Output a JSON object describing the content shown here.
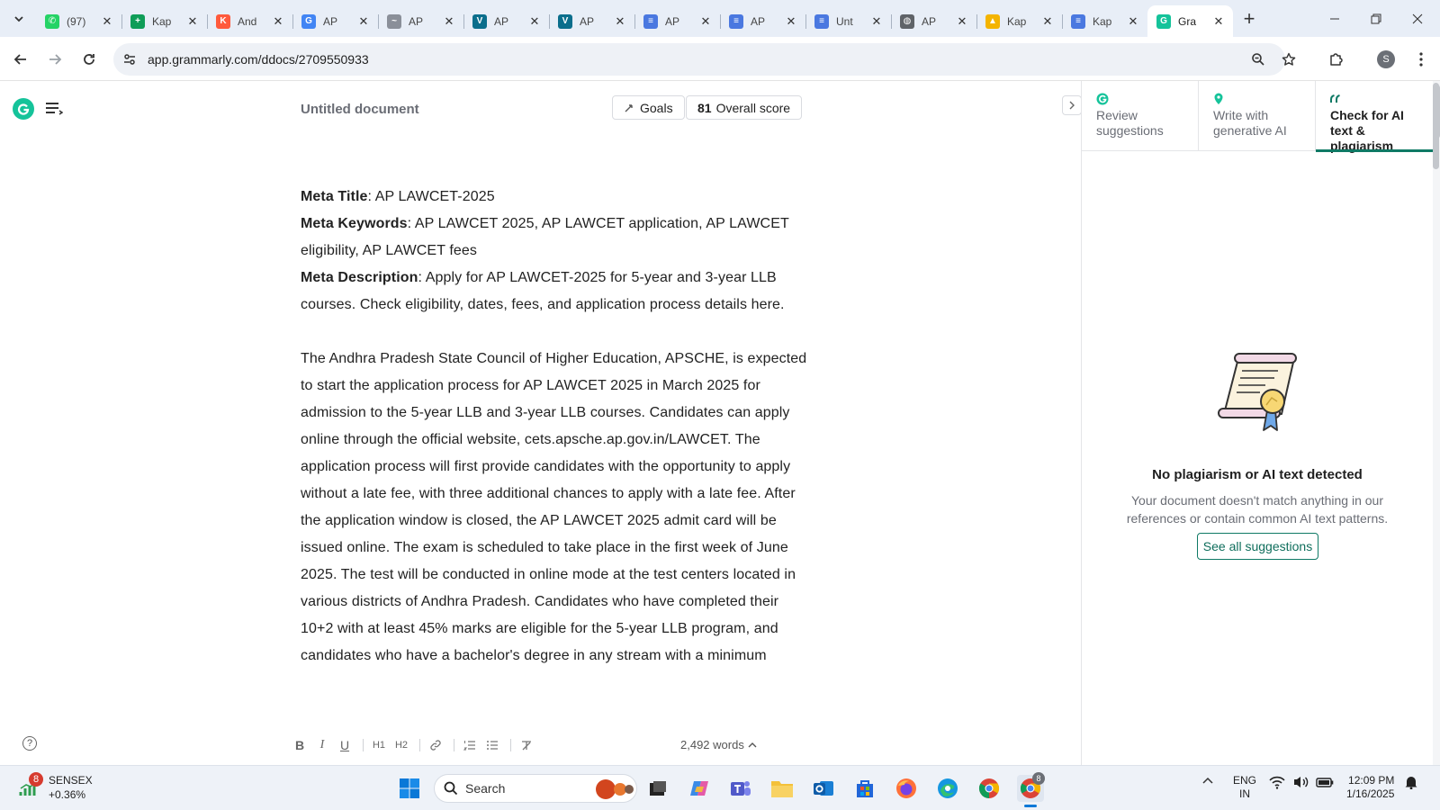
{
  "browser": {
    "tabs": [
      {
        "title": "(97)",
        "favicon": "whatsapp-icon",
        "color": "#25d366",
        "glyph": "✆"
      },
      {
        "title": "Kap",
        "favicon": "sheets-icon",
        "color": "#0f9d58",
        "glyph": "+"
      },
      {
        "title": "And",
        "favicon": "k-icon",
        "color": "#ff5a3c",
        "glyph": "K"
      },
      {
        "title": "AP",
        "favicon": "google-icon",
        "color": "#4285f4",
        "glyph": "G"
      },
      {
        "title": "AP",
        "favicon": "site-icon",
        "color": "#8a8f99",
        "glyph": "~"
      },
      {
        "title": "AP",
        "favicon": "v-icon",
        "color": "#0b6e8c",
        "glyph": "V"
      },
      {
        "title": "AP",
        "favicon": "v-icon",
        "color": "#0b6e8c",
        "glyph": "V"
      },
      {
        "title": "AP",
        "favicon": "docs-icon",
        "color": "#4a78e0",
        "glyph": "≡"
      },
      {
        "title": "AP",
        "favicon": "docs-icon",
        "color": "#4a78e0",
        "glyph": "≡"
      },
      {
        "title": "Unt",
        "favicon": "docs-icon",
        "color": "#4a78e0",
        "glyph": "≡"
      },
      {
        "title": "AP",
        "favicon": "globe-icon",
        "color": "#5f6368",
        "glyph": "◍"
      },
      {
        "title": "Kap",
        "favicon": "drive-icon",
        "color": "#f4b400",
        "glyph": "▲"
      },
      {
        "title": "Kap",
        "favicon": "docs-icon",
        "color": "#4a78e0",
        "glyph": "≡"
      },
      {
        "title": "Gra",
        "favicon": "grammarly-icon",
        "color": "#15c39a",
        "glyph": "G",
        "active": true
      }
    ],
    "url": "app.grammarly.com/ddocs/2709550933",
    "profile_initial": "S"
  },
  "editor": {
    "doc_title": "Untitled document",
    "goals_label": "Goals",
    "score_value": "81",
    "score_label": "Overall score",
    "meta_title_label": "Meta Title",
    "meta_title_text": ": AP LAWCET-2025",
    "meta_keywords_label": "Meta Keywords",
    "meta_keywords_text": ": AP LAWCET 2025, AP LAWCET application, AP LAWCET eligibility, AP LAWCET fees",
    "meta_description_label": "Meta Description",
    "meta_description_text": ": Apply for AP LAWCET-2025 for 5-year and 3-year LLB courses. Check eligibility, dates, fees, and application process details here.",
    "body_text": "The Andhra Pradesh State Council of Higher Education, APSCHE, is expected to start the application process for AP LAWCET 2025 in March 2025 for admission to the 5-year LLB and 3-year LLB courses. Candidates can apply online through the official website, cets.apsche.ap.gov.in/LAWCET. The application process will first provide candidates with the opportunity to apply without a late fee, with three additional chances to apply with a late fee. After the application window is closed, the AP LAWCET 2025 admit card will be issued online. The exam is scheduled to take place in the first week of June 2025. The test will be conducted in online mode at the test centers located in various districts of Andhra Pradesh. Candidates who have completed their 10+2 with at least 45% marks are eligible for the 5-year LLB program, and candidates who have a bachelor's degree in any stream with a minimum",
    "word_count": "2,492 words",
    "format_tools": [
      "B",
      "I",
      "U",
      "H1",
      "H2"
    ]
  },
  "panel": {
    "tabs": [
      {
        "label": "Review suggestions",
        "icon": "grammarly-icon"
      },
      {
        "label": "Write with generative AI",
        "icon": "pin-icon"
      },
      {
        "label": "Check for AI text & plagiarism",
        "icon": "quote-icon",
        "active": true
      }
    ],
    "empty_title": "No plagiarism or AI text detected",
    "empty_desc": "Your document doesn't match anything in our references or contain common AI text patterns.",
    "see_all_label": "See all suggestions"
  },
  "taskbar": {
    "sensex_badge": "8",
    "sensex_name": "SENSEX",
    "sensex_change": "+0.36%",
    "search_placeholder": "Search",
    "lang_line1": "ENG",
    "lang_line2": "IN",
    "time": "12:09 PM",
    "date": "1/16/2025",
    "chrome_badge": "8"
  },
  "colors": {
    "grammarly_green": "#15c39a",
    "accent_teal": "#0f7a65",
    "tabstrip_bg": "#e8eef7"
  }
}
